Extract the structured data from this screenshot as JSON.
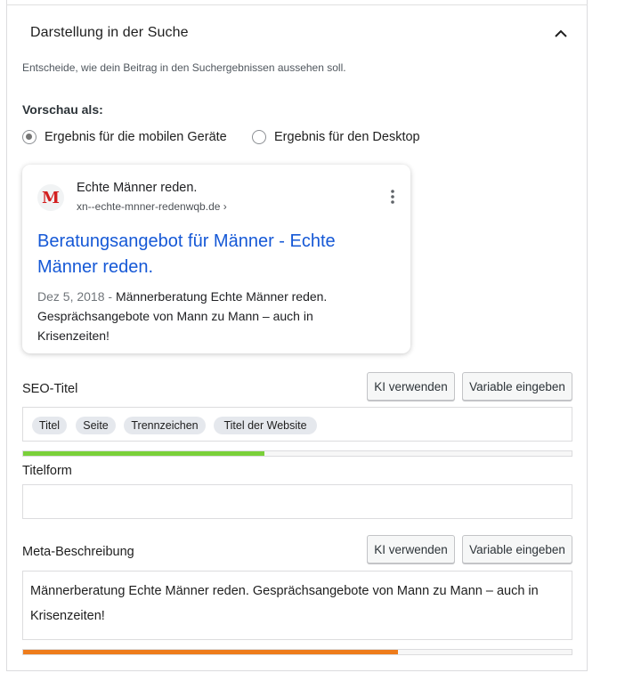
{
  "section": {
    "title": "Darstellung in der Suche",
    "intro": "Entscheide, wie dein Beitrag in den Suchergebnissen aussehen soll.",
    "collapse_icon": "chevron-up-icon"
  },
  "preview": {
    "label": "Vorschau als:",
    "options": [
      {
        "label": "Ergebnis für die mobilen Geräte",
        "checked": true
      },
      {
        "label": "Ergebnis für den Desktop",
        "checked": false
      }
    ]
  },
  "serp": {
    "favicon_letter": "M",
    "site_name": "Echte Männer reden.",
    "url": "xn--echte-mnner-redenwqb.de ›",
    "title": "Beratungsangebot für Männer - Echte Männer reden.",
    "date": "Dez 5, 2018",
    "separator": " - ",
    "description": "Männerberatung Echte Männer reden. Gesprächsangebote von Mann zu Mann – auch in Krisenzeiten!"
  },
  "seo_title": {
    "label": "SEO-Titel",
    "ai_button": "KI verwenden",
    "variable_button": "Variable eingeben",
    "tags": [
      "Titel",
      "Seite",
      "Trennzeichen",
      "Titel der Website"
    ],
    "progress": 0.44,
    "progress_color": "#7ad03a"
  },
  "title_form": {
    "label": "Titelform",
    "value": ""
  },
  "meta": {
    "label": "Meta-Beschreibung",
    "ai_button": "KI verwenden",
    "variable_button": "Variable eingeben",
    "value": "Männerberatung Echte Männer reden. Gesprächsangebote von Mann zu Mann – auch in Krisenzeiten!",
    "progress": 0.684,
    "progress_color": "#ee7c1b"
  }
}
